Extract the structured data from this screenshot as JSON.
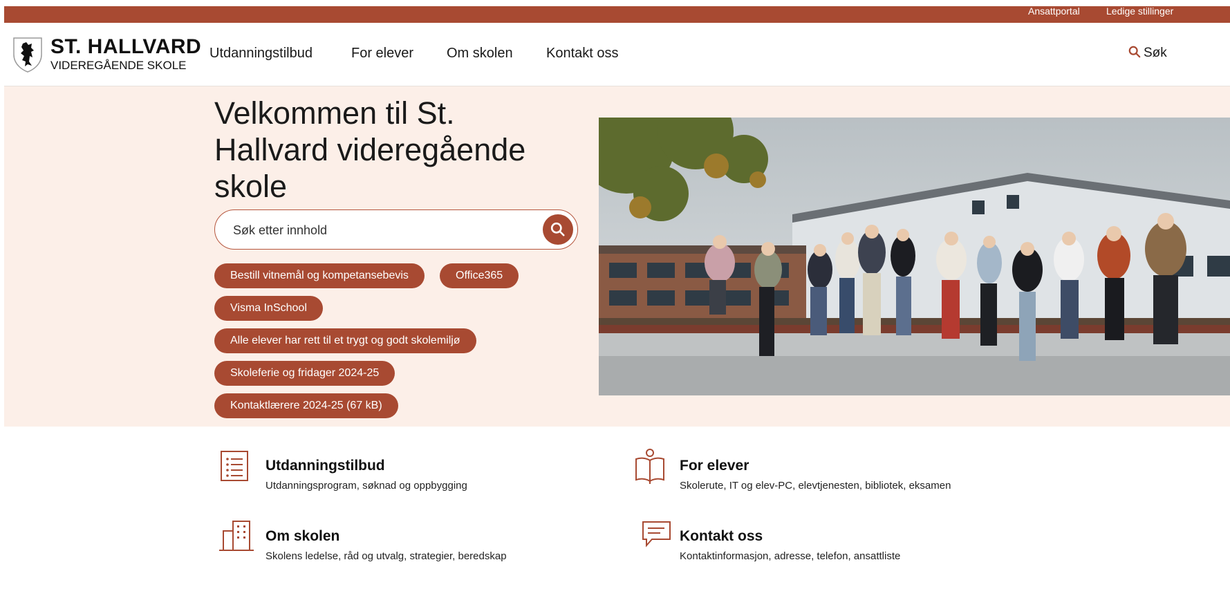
{
  "topbar": {
    "links": [
      "Ansattportal",
      "Ledige stillinger"
    ]
  },
  "logo": {
    "name": "ST. HALLVARD",
    "subtitle": "VIDEREGÅENDE SKOLE"
  },
  "nav": {
    "items": [
      "Utdanningstilbud",
      "For elever",
      "Om skolen",
      "Kontakt oss"
    ],
    "search_label": "Søk"
  },
  "hero": {
    "title": "Velkommen til St. Hallvard videregående skole",
    "search_placeholder": "Søk etter innhold",
    "quick_links": [
      "Bestill vitnemål og kompetansebevis",
      "Office365",
      "Visma InSchool",
      "Alle elever har rett til et trygt og godt skolemiljø",
      "Skoleferie og fridager 2024-25",
      "Kontaktlærere 2024-25 (67 kB)"
    ]
  },
  "sections": [
    {
      "title": "Utdanningstilbud",
      "description": "Utdanningsprogram, søknad og oppbygging",
      "icon": "list-icon"
    },
    {
      "title": "For elever",
      "description": "Skolerute, IT og elev-PC, elevtjenesten, bibliotek, eksamen",
      "icon": "reader-book-icon"
    },
    {
      "title": "Om skolen",
      "description": "Skolens ledelse, råd og utvalg, strategier, beredskap",
      "icon": "building-icon"
    },
    {
      "title": "Kontakt oss",
      "description": "Kontaktinformasjon, adresse, telefon, ansattliste",
      "icon": "chat-bubble-icon"
    }
  ],
  "colors": {
    "accent": "#a84a32",
    "hero_background": "#fcefe8"
  }
}
